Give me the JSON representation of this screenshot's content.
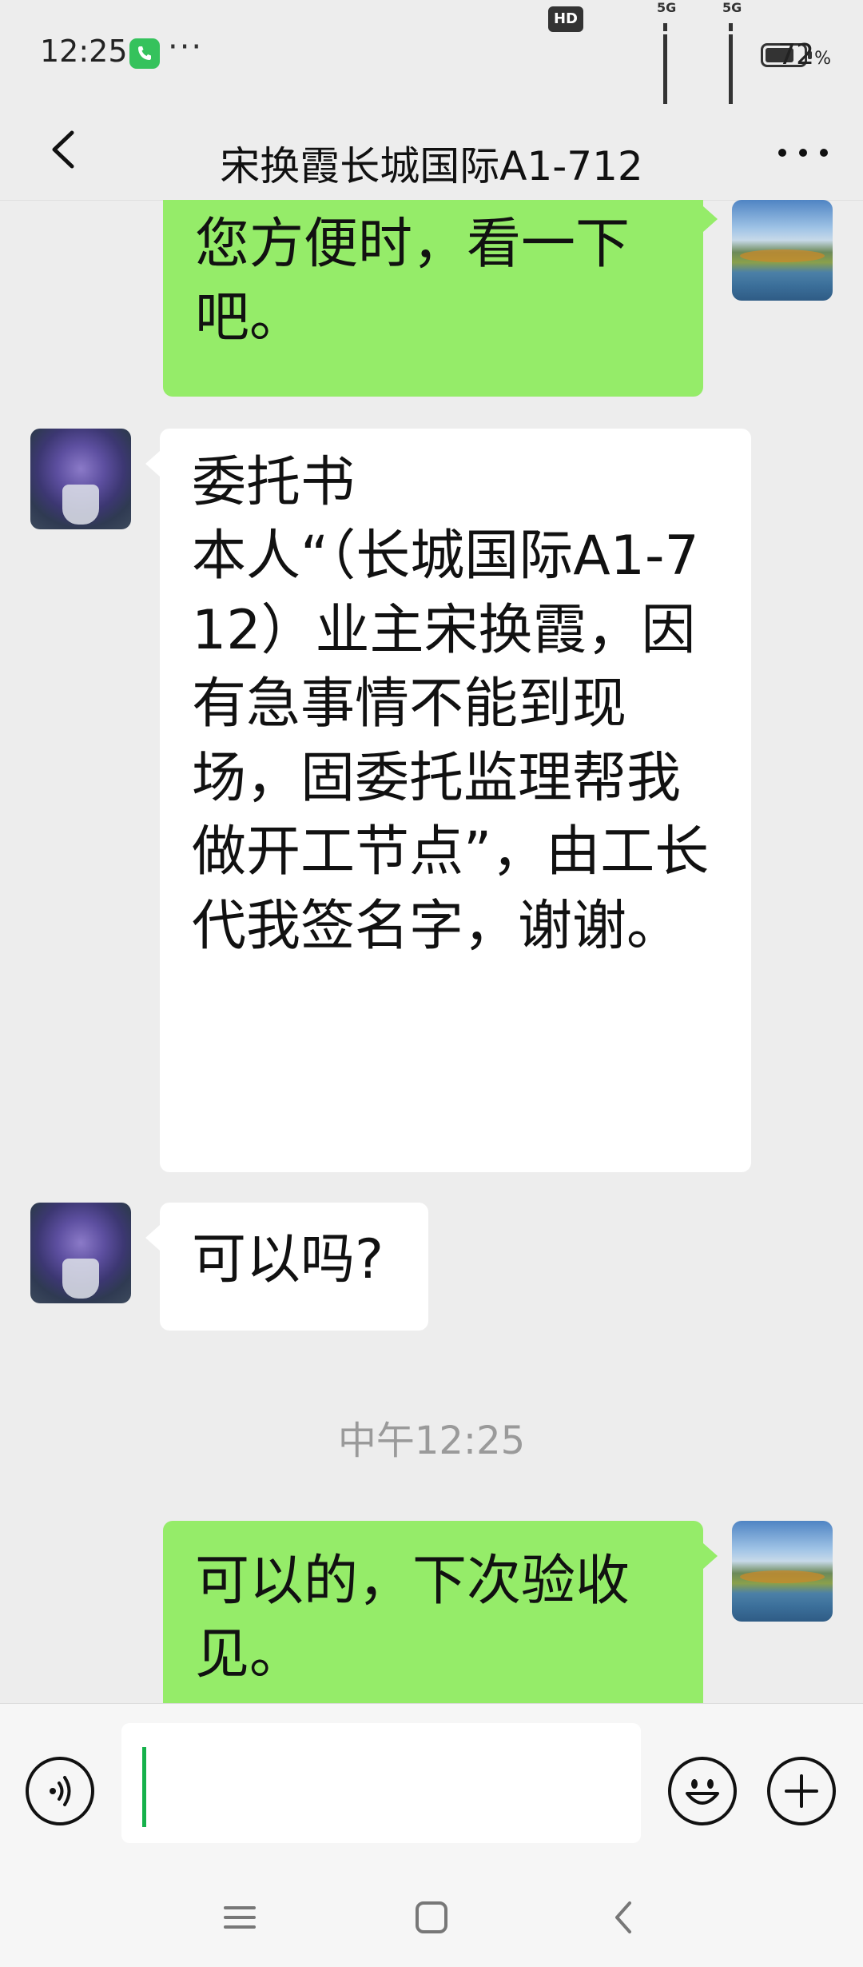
{
  "status_bar": {
    "time": "12:25",
    "more_indicator": "···",
    "hd_badge": "HD",
    "network_1": "5G",
    "network_2": "5G",
    "battery_percent": "72",
    "battery_unit": "%"
  },
  "nav": {
    "title": "宋换霞长城国际A1-712",
    "back_icon": "chevron-left-icon",
    "more_icon": "more-dots-icon"
  },
  "messages": [
    {
      "sender": "self",
      "text": "您方便时，看一下吧。"
    },
    {
      "sender": "other",
      "text": "委托书\n本人“（长城国际A1-712）业主宋换霞，因有急事情不能到现场，固委托监理帮我做开工节点”，由工长代我签名字，谢谢。"
    },
    {
      "sender": "other",
      "text": "可以吗?"
    },
    {
      "sender": "system",
      "text": "中午12:25"
    },
    {
      "sender": "self",
      "text": "可以的，下次验收见。"
    }
  ],
  "input_bar": {
    "value": "",
    "voice_icon": "voice-icon",
    "emoji_icon": "emoji-icon",
    "plus_icon": "plus-icon"
  },
  "system_nav": {
    "menu_icon": "menu-icon",
    "home_icon": "home-icon",
    "back_icon": "back-icon"
  },
  "colors": {
    "self_bubble": "#95ec69",
    "other_bubble": "#ffffff",
    "background": "#ededed",
    "caret": "#16b14b"
  }
}
